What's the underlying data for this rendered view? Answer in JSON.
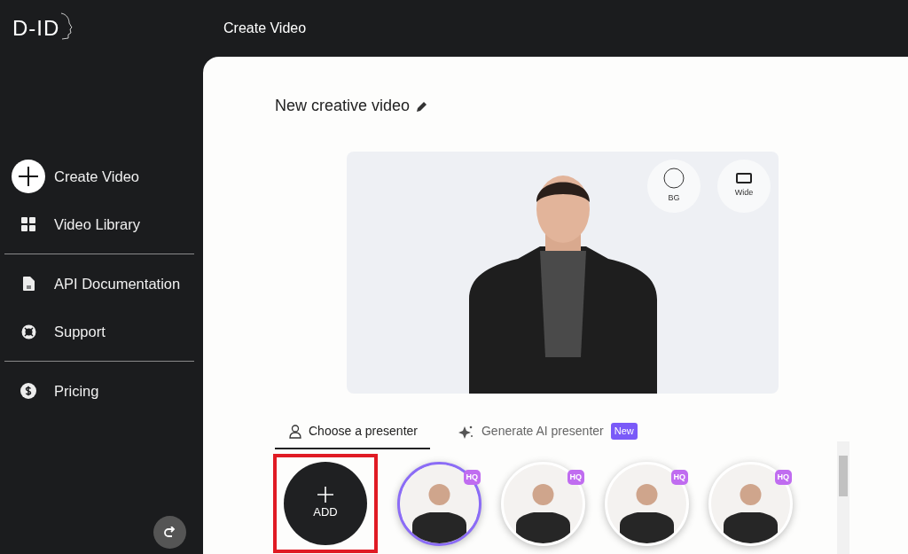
{
  "logo": {
    "text": "D-ID"
  },
  "header": {
    "title": "Create Video"
  },
  "sidebar": {
    "groups": [
      {
        "items": [
          {
            "label": "Create Video",
            "selected": true
          },
          {
            "label": "Video Library",
            "selected": false
          }
        ]
      },
      {
        "items": [
          {
            "label": "API Documentation",
            "selected": false
          },
          {
            "label": "Support",
            "selected": false
          }
        ]
      },
      {
        "items": [
          {
            "label": "Pricing",
            "selected": false
          }
        ]
      }
    ]
  },
  "video": {
    "title": "New creative video"
  },
  "preview_buttons": [
    {
      "label": "BG",
      "kind": "circle"
    },
    {
      "label": "Wide",
      "kind": "rect"
    }
  ],
  "tabs": [
    {
      "label": "Choose a presenter",
      "selected": true
    },
    {
      "label": "Generate AI presenter",
      "selected": false,
      "badge": "New"
    }
  ],
  "add_button": {
    "label": "ADD",
    "highlighted": true
  },
  "presenters": [
    {
      "badge": "HQ",
      "selected": true
    },
    {
      "badge": "HQ",
      "selected": false
    },
    {
      "badge": "HQ",
      "selected": false
    },
    {
      "badge": "HQ",
      "selected": false
    }
  ]
}
